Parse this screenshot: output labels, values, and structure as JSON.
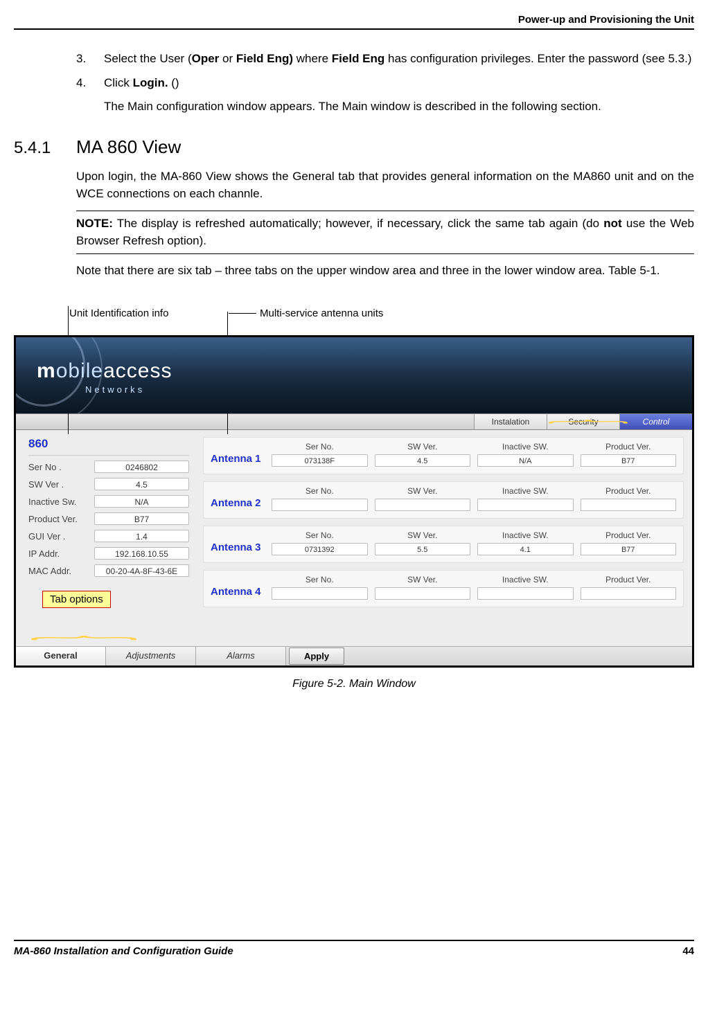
{
  "header": {
    "title": "Power-up and Provisioning the Unit"
  },
  "steps": {
    "s3": {
      "num": "3.",
      "t1": "Select the User (",
      "b1": "Oper",
      "t2": " or ",
      "b2": "Field Eng)",
      "t3": " where ",
      "b3": "Field Eng",
      "t4": " has configuration privileges. Enter the password (see  5.3.)"
    },
    "s4": {
      "num": "4.",
      "t1": "Click ",
      "b1": "Login.",
      "t2": "  ()"
    },
    "after4": "The Main configuration window appears. The Main window is described in the following section."
  },
  "section": {
    "num": "5.4.1",
    "title": "MA 860 View"
  },
  "para1": "Upon login, the MA-860 View shows the General tab that provides general information on the MA860 unit and on the WCE connections on each channle.",
  "note": {
    "b1": "NOTE:",
    "t1": " The display is refreshed automatically; however, if necessary, click the same tab again (do ",
    "b2": "not",
    "t2": " use the Web Browser Refresh option)."
  },
  "para2": "Note that there are six tab – three tabs on the upper window area and three in the lower window area. Table  5-1.",
  "callouts": {
    "unit": "Unit Identification info",
    "multi": "Multi-service antenna units",
    "tabopt": "Tab options"
  },
  "logo": {
    "m": "m",
    "obile": "obile",
    "access": "access",
    "sub": "Networks"
  },
  "toptabs": [
    "Instalation",
    "Security",
    "Control"
  ],
  "unit860": {
    "title": "860",
    "rows": [
      {
        "label": "Ser No .",
        "val": "0246802"
      },
      {
        "label": "SW Ver .",
        "val": "4.5"
      },
      {
        "label": "Inactive Sw.",
        "val": "N/A"
      },
      {
        "label": "Product Ver.",
        "val": "B77"
      },
      {
        "label": "GUI Ver .",
        "val": "1.4"
      },
      {
        "label": "IP Addr.",
        "val": "192.168.10.55"
      },
      {
        "label": "MAC Addr.",
        "val": "00-20-4A-8F-43-6E"
      }
    ]
  },
  "antcols": [
    "Ser No.",
    "SW Ver.",
    "Inactive SW.",
    "Product Ver."
  ],
  "antennas": [
    {
      "name": "Antenna 1",
      "vals": [
        "073138F",
        "4.5",
        "N/A",
        "B77"
      ]
    },
    {
      "name": "Antenna 2",
      "vals": [
        "",
        "",
        "",
        ""
      ]
    },
    {
      "name": "Antenna 3",
      "vals": [
        "0731392",
        "5.5",
        "4.1",
        "B77"
      ]
    },
    {
      "name": "Antenna 4",
      "vals": [
        "",
        "",
        "",
        ""
      ]
    }
  ],
  "bottomtabs": [
    "General",
    "Adjustments",
    "Alarms"
  ],
  "apply": "Apply",
  "figcap": "Figure 5-2. Main Window",
  "footer": {
    "left": "MA-860 Installation and Configuration Guide",
    "right": "44"
  }
}
